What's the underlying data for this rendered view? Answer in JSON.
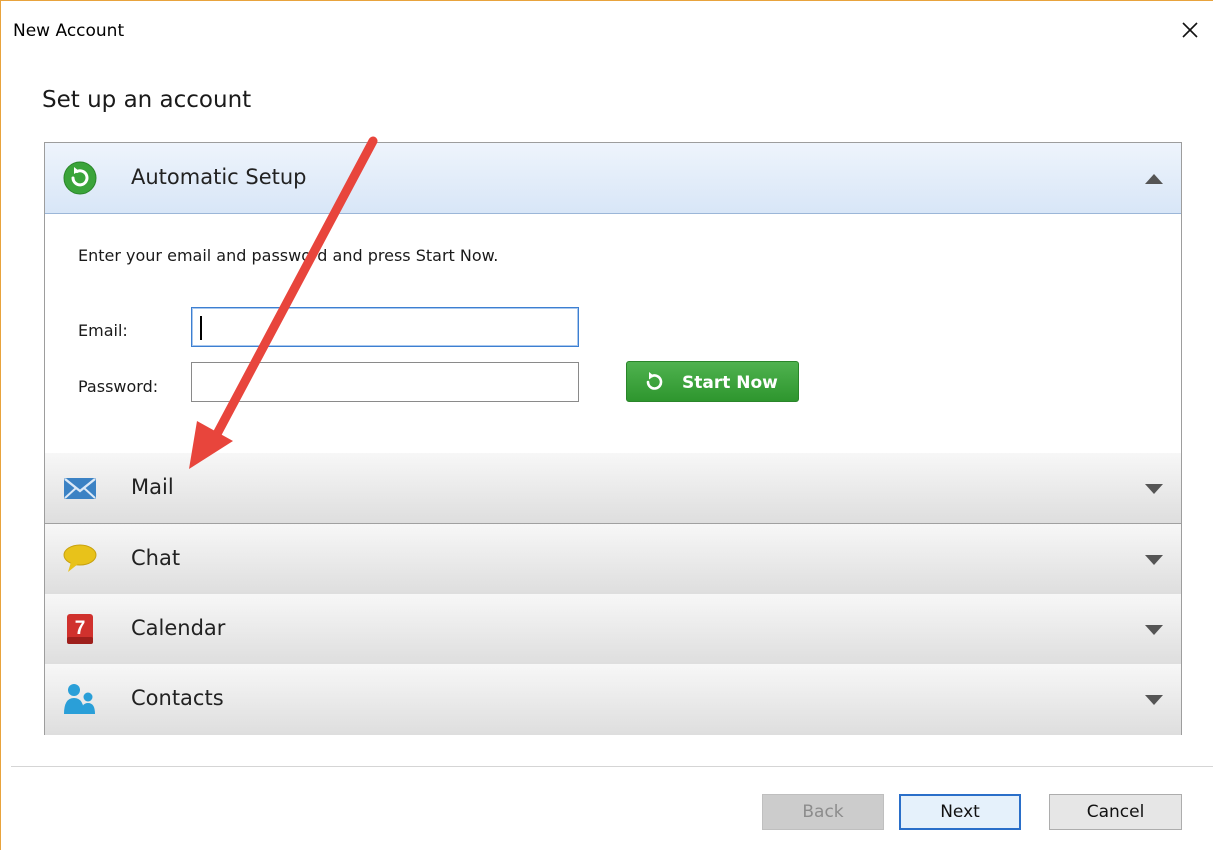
{
  "window": {
    "title": "New Account",
    "close_icon": "close-icon"
  },
  "heading": "Set up an account",
  "automatic_setup": {
    "label": "Automatic Setup",
    "icon": "refresh-circle-icon",
    "expanded": true,
    "intro": "Enter your email and password and press Start Now.",
    "email_label": "Email:",
    "email_value": "",
    "password_label": "Password:",
    "password_value": "",
    "start_button": "Start Now"
  },
  "sections": [
    {
      "label": "Mail",
      "icon": "envelope-icon",
      "expanded": false
    },
    {
      "label": "Chat",
      "icon": "speech-bubble-icon",
      "expanded": false
    },
    {
      "label": "Calendar",
      "icon": "calendar-icon",
      "expanded": false,
      "icon_text": "7"
    },
    {
      "label": "Contacts",
      "icon": "people-icon",
      "expanded": false
    }
  ],
  "footer": {
    "back": "Back",
    "next": "Next",
    "cancel": "Cancel",
    "back_enabled": false
  },
  "colors": {
    "accent_blue": "#2a6fc9",
    "start_green": "#3aa43a",
    "annotation_arrow": "#e8453c",
    "window_border": "#e8a33d"
  }
}
